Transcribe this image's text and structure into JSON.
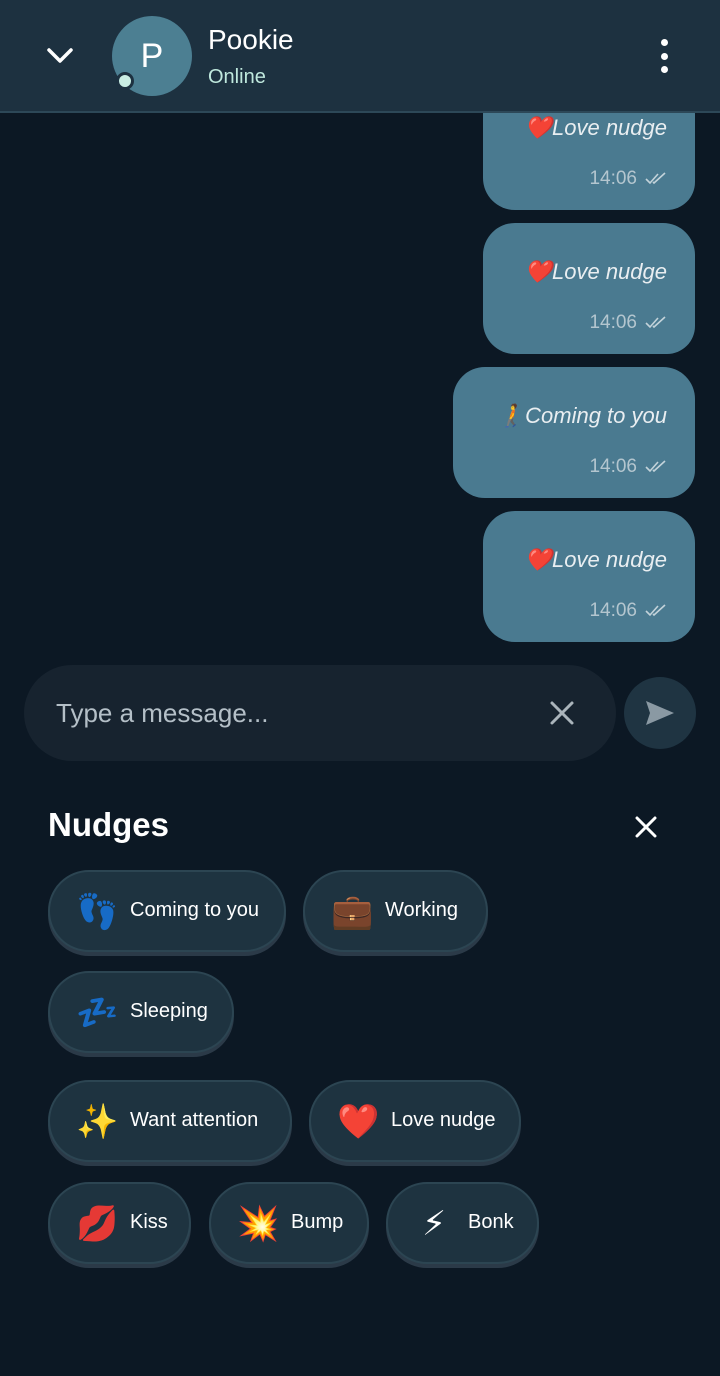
{
  "header": {
    "avatar_initial": "P",
    "contact_name": "Pookie",
    "status": "Online"
  },
  "messages": [
    {
      "emoji": "❤️",
      "text": "Love nudge",
      "time": "14:06"
    },
    {
      "emoji": "❤️",
      "text": "Love nudge",
      "time": "14:06"
    },
    {
      "emoji": "🚶",
      "text": "Coming to you",
      "time": "14:06"
    },
    {
      "emoji": "❤️",
      "text": "Love nudge",
      "time": "14:06"
    }
  ],
  "composer": {
    "placeholder": "Type a message..."
  },
  "nudges": {
    "title": "Nudges",
    "items": [
      {
        "emoji": "👣",
        "label": "Coming to you"
      },
      {
        "emoji": "💼",
        "label": "Working"
      },
      {
        "emoji": "💤",
        "label": "Sleeping"
      },
      {
        "emoji": "✨",
        "label": "Want attention"
      },
      {
        "emoji": "❤️",
        "label": "Love nudge"
      },
      {
        "emoji": "💋",
        "label": "Kiss"
      },
      {
        "emoji": "💥",
        "label": "Bump"
      },
      {
        "emoji": "⚡",
        "label": "Bonk"
      }
    ]
  },
  "colors": {
    "background": "#0c1824",
    "header": "#1d3140",
    "bubble": "#4a7a90",
    "chip": "#1e3340",
    "online": "#bfe8dd"
  }
}
